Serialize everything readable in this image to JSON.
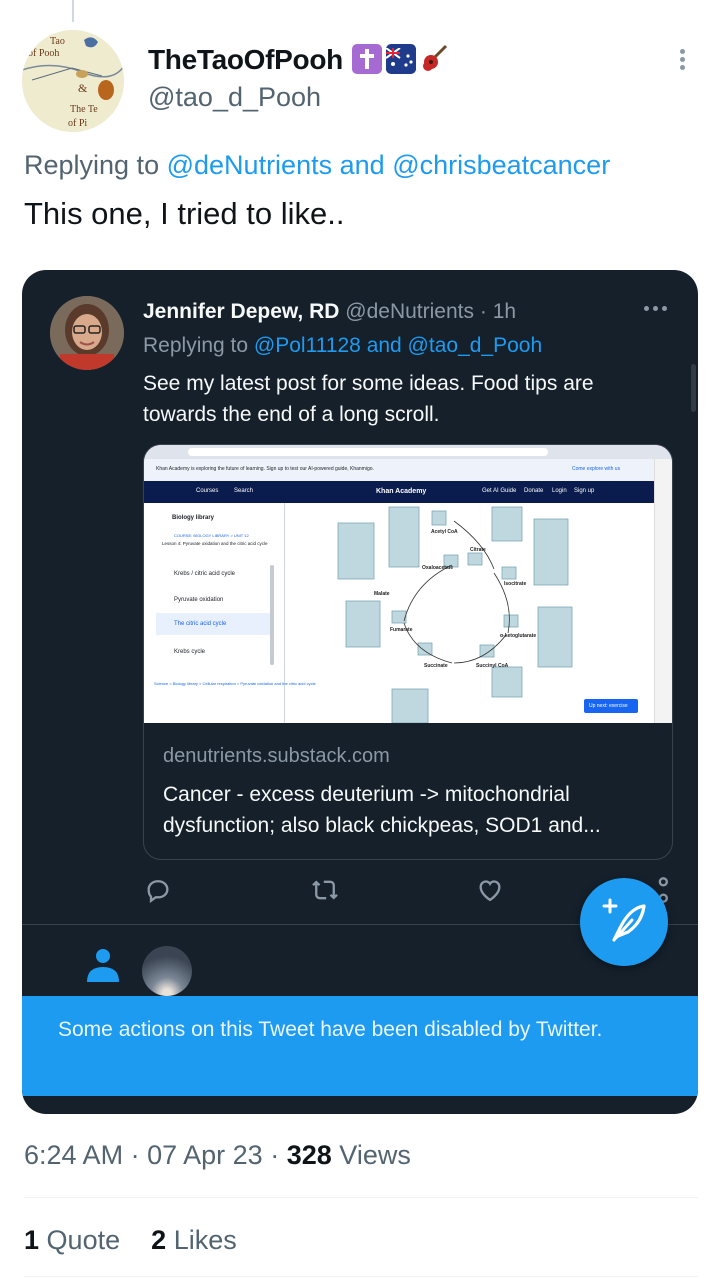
{
  "author": {
    "display_name": "TheTaoOfPooh",
    "handle": "@tao_d_Pooh",
    "badges": [
      "latin-cross-emoji",
      "australia-flag-emoji",
      "guitar-emoji"
    ],
    "avatar_text": [
      "Tao",
      "of Pooh",
      "&",
      "The Te",
      "of Pi"
    ]
  },
  "reply": {
    "prefix": "Replying to",
    "mention1": "@deNutrients",
    "joiner": "and",
    "mention2": "@chrisbeatcancer"
  },
  "tweet": {
    "text": "This one, I tried to like.."
  },
  "quoted": {
    "name": "Jennifer Depew, RD",
    "handle": "@deNutrients",
    "separator": "·",
    "time": "1h",
    "reply_prefix": "Replying to",
    "reply_mentions": "@Pol11128 and @tao_d_Pooh",
    "text": "See my latest post for some ideas. Food tips are towards the end of a long scroll.",
    "link_card": {
      "domain": "denutrients.substack.com",
      "title": "Cancer - excess deuterium -> mitochondrial dysfunction; also black chickpeas, SOD1 and...",
      "screenshot": {
        "banner": "Khan Academy is exploring the future of learning. Sign up to test our AI-powered guide, Khanmigo.",
        "banner_link": "Come explore with us",
        "nav_courses": "Courses",
        "nav_search": "Search",
        "logo": "Khan Academy",
        "nav_right": [
          "Get AI Guide",
          "Donate",
          "Login",
          "Sign up"
        ],
        "side_title": "Biology library",
        "course_label": "COURSE: BIOLOGY LIBRARY > UNIT 12",
        "lesson": "Lesson 4: Pyruvate oxidation and the citric acid cycle",
        "side_items": [
          "Krebs / citric acid cycle",
          "Pyruvate oxidation",
          "The citric acid cycle",
          "Krebs cycle"
        ],
        "side_footer": "Science > Biology library > Cellular respiration > Pyruvate oxidation and the citric acid cycle",
        "diagram_labels": [
          "Acetyl CoA",
          "Citrate",
          "Isocitrate",
          "Oxaloacetate",
          "Malate",
          "Fumarate",
          "Succinate",
          "Succinyl CoA",
          "α-ketoglutarate"
        ],
        "next_button": "Up next: exercise"
      }
    },
    "actions": [
      "reply-icon",
      "retweet-icon",
      "like-icon",
      "share-icon"
    ],
    "notice": "Some actions on this Tweet have been disabled by Twitter."
  },
  "meta": {
    "time": "6:24 AM",
    "sep": "·",
    "date": "07 Apr 23",
    "views_count": "328",
    "views_label": "Views"
  },
  "stats": {
    "quotes_count": "1",
    "quotes_label": "Quote",
    "likes_count": "2",
    "likes_label": "Likes"
  },
  "colors": {
    "accent": "#1d9bf0",
    "dark_bg": "#15202b",
    "muted": "#536471"
  }
}
